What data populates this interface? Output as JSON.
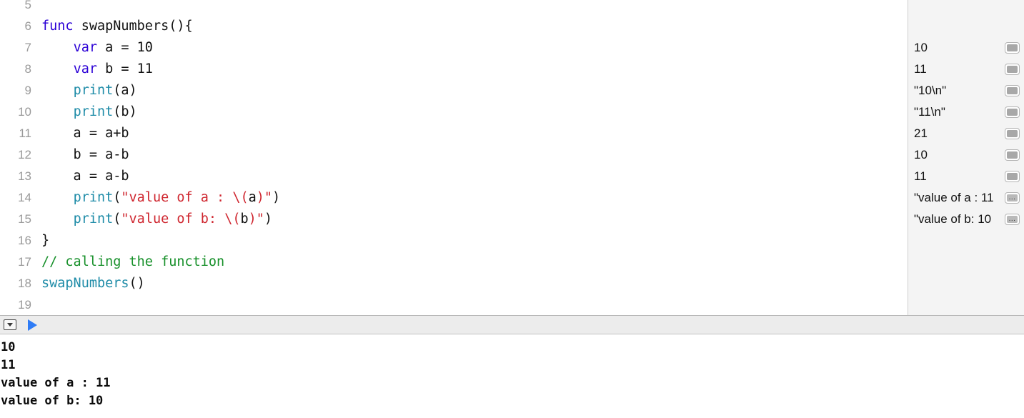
{
  "editor": {
    "lines": [
      {
        "num": "5",
        "tokens": []
      },
      {
        "num": "6",
        "tokens": [
          {
            "t": "func",
            "c": "kw"
          },
          {
            "t": " swapNumbers(){",
            "c": "pln"
          }
        ]
      },
      {
        "num": "7",
        "tokens": [
          {
            "t": "    ",
            "c": "pln"
          },
          {
            "t": "var",
            "c": "kw"
          },
          {
            "t": " a = 10",
            "c": "pln"
          }
        ]
      },
      {
        "num": "8",
        "tokens": [
          {
            "t": "    ",
            "c": "pln"
          },
          {
            "t": "var",
            "c": "kw"
          },
          {
            "t": " b = 11",
            "c": "pln"
          }
        ]
      },
      {
        "num": "9",
        "tokens": [
          {
            "t": "    ",
            "c": "pln"
          },
          {
            "t": "print",
            "c": "fn"
          },
          {
            "t": "(a)",
            "c": "pln"
          }
        ]
      },
      {
        "num": "10",
        "tokens": [
          {
            "t": "    ",
            "c": "pln"
          },
          {
            "t": "print",
            "c": "fn"
          },
          {
            "t": "(b)",
            "c": "pln"
          }
        ]
      },
      {
        "num": "11",
        "tokens": [
          {
            "t": "    a = a+b",
            "c": "pln"
          }
        ]
      },
      {
        "num": "12",
        "tokens": [
          {
            "t": "    b = a-b",
            "c": "pln"
          }
        ]
      },
      {
        "num": "13",
        "tokens": [
          {
            "t": "    a = a-b",
            "c": "pln"
          }
        ]
      },
      {
        "num": "14",
        "tokens": [
          {
            "t": "    ",
            "c": "pln"
          },
          {
            "t": "print",
            "c": "fn"
          },
          {
            "t": "(",
            "c": "pln"
          },
          {
            "t": "\"value of a : \\(",
            "c": "str"
          },
          {
            "t": "a",
            "c": "pln"
          },
          {
            "t": ")\"",
            "c": "str"
          },
          {
            "t": ")",
            "c": "pln"
          }
        ]
      },
      {
        "num": "15",
        "tokens": [
          {
            "t": "    ",
            "c": "pln"
          },
          {
            "t": "print",
            "c": "fn"
          },
          {
            "t": "(",
            "c": "pln"
          },
          {
            "t": "\"value of b: \\(",
            "c": "str"
          },
          {
            "t": "b",
            "c": "pln"
          },
          {
            "t": ")\"",
            "c": "str"
          },
          {
            "t": ")",
            "c": "pln"
          }
        ]
      },
      {
        "num": "16",
        "tokens": [
          {
            "t": "}",
            "c": "pln"
          }
        ]
      },
      {
        "num": "17",
        "tokens": [
          {
            "t": "// calling the function",
            "c": "cmt"
          }
        ]
      },
      {
        "num": "18",
        "tokens": [
          {
            "t": "swapNumbers",
            "c": "fn"
          },
          {
            "t": "()",
            "c": "pln"
          }
        ]
      },
      {
        "num": "19",
        "tokens": []
      }
    ]
  },
  "results": {
    "rows": [
      {
        "value": "10",
        "button": "quicklook-icon"
      },
      {
        "value": "11",
        "button": "quicklook-icon"
      },
      {
        "value": "\"10\\n\"",
        "button": "quicklook-icon"
      },
      {
        "value": "\"11\\n\"",
        "button": "quicklook-icon"
      },
      {
        "value": "21",
        "button": "quicklook-icon"
      },
      {
        "value": "10",
        "button": "quicklook-icon"
      },
      {
        "value": "11",
        "button": "quicklook-icon"
      },
      {
        "value": "\"value of a : 11",
        "button": "quicklook-more-icon",
        "more": "..."
      },
      {
        "value": "\"value of b: 10",
        "button": "quicklook-more-icon",
        "more": "..."
      }
    ]
  },
  "debug_bar": {
    "toggle_debug_area": "hide-debug-area-icon",
    "run": "run-playground-icon"
  },
  "console": {
    "lines": [
      "10",
      "11",
      "value of a : 11",
      "value of b: 10"
    ]
  },
  "colors": {
    "keyword": "#2b00d6",
    "function": "#1f8ca8",
    "string": "#cf262f",
    "comment": "#17902a",
    "plain": "#101010",
    "gutter": "#9a9a9a",
    "results_bg": "#f4f4f4",
    "toolbar_bg": "#ececec",
    "run_blue": "#2f7cf6"
  }
}
